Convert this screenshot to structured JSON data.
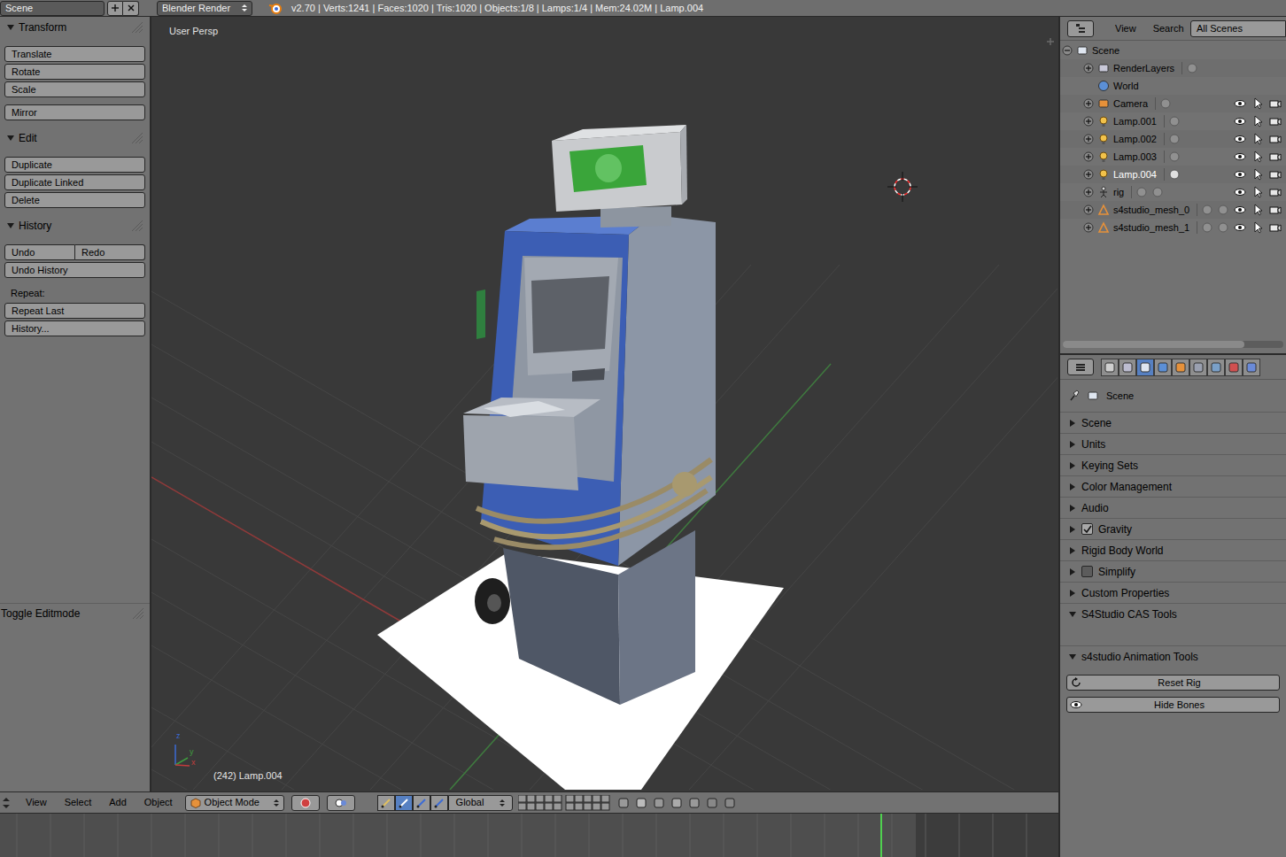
{
  "info_header": {
    "scene": "Scene",
    "render_engine": "Blender Render",
    "stats": "v2.70 | Verts:1241 | Faces:1020 | Tris:1020 | Objects:1/8 | Lamps:1/4 | Mem:24.02M | Lamp.004"
  },
  "tool_shelf": {
    "panels": [
      {
        "title": "Transform",
        "expanded": true,
        "blocks": [
          {
            "kind": "buttons",
            "rows": [
              [
                "Translate"
              ],
              [
                "Rotate"
              ],
              [
                "Scale"
              ]
            ]
          },
          {
            "kind": "buttons",
            "rows": [
              [
                "Mirror"
              ]
            ]
          }
        ]
      },
      {
        "title": "Edit",
        "expanded": true,
        "blocks": [
          {
            "kind": "buttons",
            "rows": [
              [
                "Duplicate"
              ],
              [
                "Duplicate Linked"
              ],
              [
                "Delete"
              ]
            ]
          }
        ]
      },
      {
        "title": "History",
        "expanded": true,
        "blocks": [
          {
            "kind": "buttons",
            "rows": [
              [
                "Undo",
                "Redo"
              ],
              [
                "Undo History"
              ]
            ]
          },
          {
            "kind": "label",
            "text": "Repeat:"
          },
          {
            "kind": "buttons",
            "rows": [
              [
                "Repeat Last"
              ],
              [
                "History..."
              ]
            ]
          }
        ]
      }
    ],
    "operator_panel": {
      "title": "Toggle Editmode"
    }
  },
  "viewport": {
    "view_label": "User Persp",
    "status": "(242) Lamp.004",
    "axis_labels": {
      "x": "x",
      "y": "y",
      "z": "z"
    }
  },
  "viewport_header": {
    "menus": [
      "View",
      "Select",
      "Add",
      "Object"
    ],
    "mode": "Object Mode",
    "orientation": "Global",
    "manipulators": [
      {
        "kind": "toggle",
        "selected": false
      },
      {
        "kind": "translate",
        "selected": true
      },
      {
        "kind": "rotate",
        "selected": false
      },
      {
        "kind": "scale",
        "selected": false
      }
    ]
  },
  "timeline": {
    "current_frame_level": 0.832
  },
  "outliner": {
    "menus": [
      "View",
      "Search"
    ],
    "display_mode": "All Scenes",
    "items": [
      {
        "name": "Scene",
        "kind": "scene",
        "depth": 0,
        "has_toggle": true,
        "expanded": true,
        "selected": false,
        "extra_icons": 0
      },
      {
        "name": "RenderLayers",
        "kind": "renderlayers",
        "depth": 1,
        "has_toggle": true,
        "expanded": false,
        "selected": false,
        "extra_icons": 1
      },
      {
        "name": "World",
        "kind": "world",
        "depth": 1,
        "has_toggle": false,
        "expanded": false,
        "selected": false,
        "extra_icons": 0
      },
      {
        "name": "Camera",
        "kind": "camera",
        "depth": 1,
        "has_toggle": true,
        "expanded": false,
        "selected": false,
        "extra_icons": 1,
        "visible": true,
        "selectable": true,
        "renderable": true
      },
      {
        "name": "Lamp.001",
        "kind": "lamp",
        "depth": 1,
        "has_toggle": true,
        "expanded": false,
        "selected": false,
        "extra_icons": 1,
        "visible": true,
        "selectable": true,
        "renderable": true
      },
      {
        "name": "Lamp.002",
        "kind": "lamp",
        "depth": 1,
        "has_toggle": true,
        "expanded": false,
        "selected": false,
        "extra_icons": 1,
        "visible": true,
        "selectable": true,
        "renderable": true
      },
      {
        "name": "Lamp.003",
        "kind": "lamp",
        "depth": 1,
        "has_toggle": true,
        "expanded": false,
        "selected": false,
        "extra_icons": 1,
        "visible": true,
        "selectable": true,
        "renderable": true
      },
      {
        "name": "Lamp.004",
        "kind": "lamp",
        "depth": 1,
        "has_toggle": true,
        "expanded": false,
        "selected": true,
        "extra_icons": 1,
        "visible": true,
        "selectable": true,
        "renderable": true
      },
      {
        "name": "rig",
        "kind": "armature",
        "depth": 1,
        "has_toggle": true,
        "expanded": false,
        "selected": false,
        "extra_icons": 2,
        "visible": true,
        "selectable": true,
        "renderable": true
      },
      {
        "name": "s4studio_mesh_0",
        "kind": "mesh",
        "depth": 1,
        "has_toggle": true,
        "expanded": false,
        "selected": false,
        "extra_icons": 2,
        "visible": true,
        "selectable": true,
        "renderable": true
      },
      {
        "name": "s4studio_mesh_1",
        "kind": "mesh",
        "depth": 1,
        "has_toggle": true,
        "expanded": false,
        "selected": false,
        "extra_icons": 2,
        "visible": true,
        "selectable": true,
        "renderable": true
      }
    ]
  },
  "properties": {
    "tabs": [
      {
        "kind": "render",
        "selected": false
      },
      {
        "kind": "layers",
        "selected": false
      },
      {
        "kind": "scene",
        "selected": true
      },
      {
        "kind": "world",
        "selected": false
      },
      {
        "kind": "object",
        "selected": false
      },
      {
        "kind": "constraints",
        "selected": false
      },
      {
        "kind": "modifiers",
        "selected": false
      },
      {
        "kind": "texture",
        "selected": false
      },
      {
        "kind": "physics",
        "selected": false
      }
    ],
    "breadcrumb": "Scene",
    "panels": [
      {
        "title": "Scene",
        "expanded": false,
        "kind": "plain"
      },
      {
        "title": "Units",
        "expanded": false,
        "kind": "plain"
      },
      {
        "title": "Keying Sets",
        "expanded": false,
        "kind": "plain"
      },
      {
        "title": "Color Management",
        "expanded": false,
        "kind": "plain"
      },
      {
        "title": "Audio",
        "expanded": false,
        "kind": "plain"
      },
      {
        "title": "Gravity",
        "expanded": false,
        "kind": "checkbox",
        "checked": true
      },
      {
        "title": "Rigid Body World",
        "expanded": false,
        "kind": "plain"
      },
      {
        "title": "Simplify",
        "expanded": false,
        "kind": "checkbox",
        "checked": false
      },
      {
        "title": "Custom Properties",
        "expanded": false,
        "kind": "plain"
      },
      {
        "title": "S4Studio CAS Tools",
        "expanded": true,
        "kind": "plain",
        "buttons": []
      },
      {
        "title": "s4studio Animation Tools",
        "expanded": true,
        "kind": "plain",
        "buttons": [
          {
            "label": "Reset Rig",
            "kind": "refresh"
          },
          {
            "label": "Hide Bones",
            "kind": "eye"
          }
        ]
      }
    ]
  }
}
